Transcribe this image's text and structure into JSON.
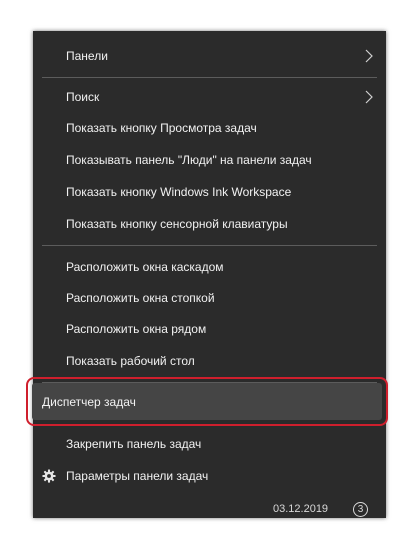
{
  "menu": {
    "items": [
      {
        "label": "Панели",
        "has_submenu": true
      },
      {
        "label": "Поиск",
        "has_submenu": true
      },
      {
        "label": "Показать кнопку Просмотра задач"
      },
      {
        "label": "Показывать панель \"Люди\" на панели задач"
      },
      {
        "label": "Показать кнопку Windows Ink Workspace"
      },
      {
        "label": "Показать кнопку сенсорной клавиатуры"
      },
      {
        "label": "Расположить окна каскадом"
      },
      {
        "label": "Расположить окна стопкой"
      },
      {
        "label": "Расположить окна рядом"
      },
      {
        "label": "Показать рабочий стол"
      },
      {
        "label": "Диспетчер задач",
        "highlighted": true
      },
      {
        "label": "Закрепить панель задач"
      },
      {
        "label": "Параметры панели задач",
        "icon": "gear-icon"
      }
    ]
  },
  "taskbar": {
    "date": "03.12.2019",
    "notification_count": "3"
  },
  "colors": {
    "menu_background": "#2b2b2b",
    "menu_text": "#f2f2f2",
    "separator": "#5c5c5c",
    "highlight_background": "#454545",
    "highlight_border": "#cf1f2d"
  }
}
